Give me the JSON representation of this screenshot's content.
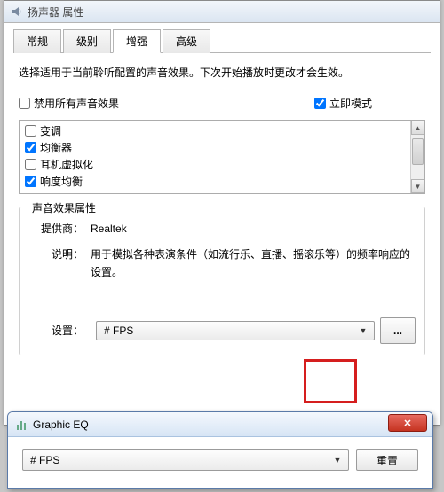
{
  "window": {
    "title": "扬声器 属性"
  },
  "tabs": [
    {
      "label": "常规"
    },
    {
      "label": "级别"
    },
    {
      "label": "增强"
    },
    {
      "label": "高级"
    }
  ],
  "intro": "选择适用于当前聆听配置的声音效果。下次开始播放时更改才会生效。",
  "options": {
    "disable_all": {
      "label": "禁用所有声音效果",
      "checked": false
    },
    "immediate": {
      "label": "立即模式",
      "checked": true
    }
  },
  "effects": [
    {
      "label": "变调",
      "checked": false
    },
    {
      "label": "均衡器",
      "checked": true
    },
    {
      "label": "耳机虚拟化",
      "checked": false
    },
    {
      "label": "响度均衡",
      "checked": true
    }
  ],
  "group": {
    "title": "声音效果属性",
    "provider_label": "提供商：",
    "provider_value": "Realtek",
    "desc_label": "说明：",
    "desc_value": "用于模拟各种表演条件（如流行乐、直播、摇滚乐等）的频率响应的设置。",
    "setting_label": "设置：",
    "setting_value": "# FPS",
    "browse_label": "..."
  },
  "eq": {
    "title": "Graphic EQ",
    "preset": "# FPS",
    "reset_label": "重置"
  }
}
